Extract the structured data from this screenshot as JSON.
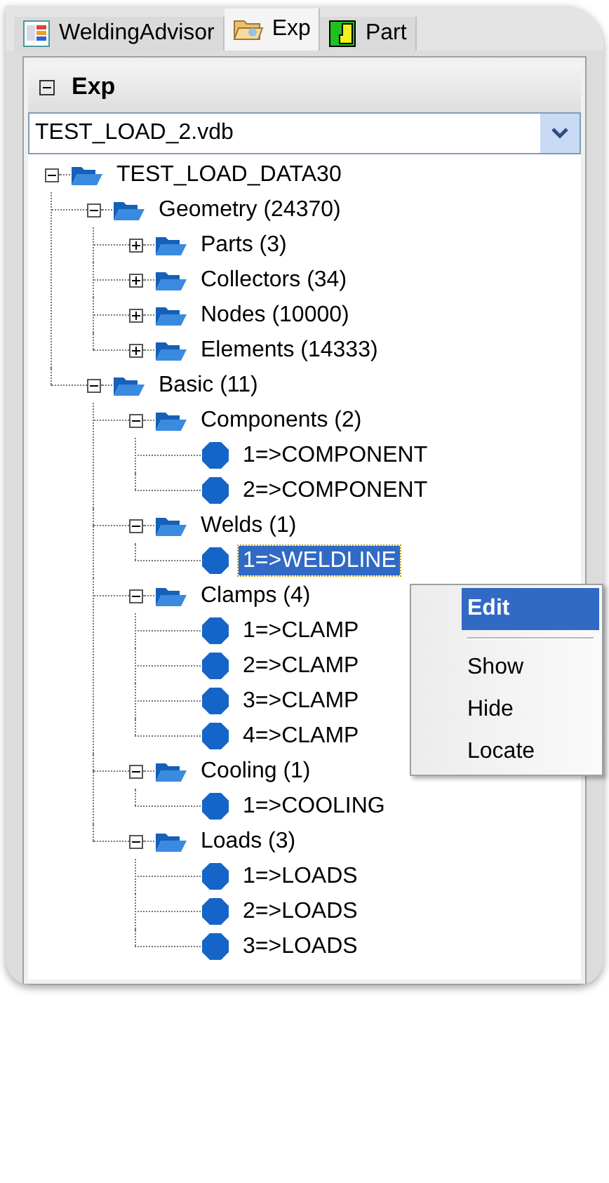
{
  "tabs": [
    {
      "label": "WeldingAdvisor",
      "kind": "chart",
      "selected": false
    },
    {
      "label": "Exp",
      "kind": "folder",
      "selected": true
    },
    {
      "label": "Part",
      "kind": "part",
      "selected": false
    }
  ],
  "panel": {
    "title": "Exp",
    "expanded": true
  },
  "file_dropdown": {
    "value": "TEST_LOAD_2.vdb"
  },
  "tree": [
    {
      "label": "TEST_LOAD_DATA30",
      "kind": "folder",
      "expanded": true,
      "selected": false,
      "children": [
        {
          "label": "Geometry (24370)",
          "kind": "folder",
          "expanded": true,
          "selected": false,
          "children": [
            {
              "label": "Parts (3)",
              "kind": "folder",
              "expanded": false,
              "selected": false
            },
            {
              "label": "Collectors (34)",
              "kind": "folder",
              "expanded": false,
              "selected": false
            },
            {
              "label": "Nodes (10000)",
              "kind": "folder",
              "expanded": false,
              "selected": false
            },
            {
              "label": "Elements (14333)",
              "kind": "folder",
              "expanded": false,
              "selected": false
            }
          ]
        },
        {
          "label": "Basic (11)",
          "kind": "folder",
          "expanded": true,
          "selected": false,
          "children": [
            {
              "label": "Components (2)",
              "kind": "folder",
              "expanded": true,
              "selected": false,
              "children": [
                {
                  "label": "1=>COMPONENT",
                  "kind": "leaf",
                  "selected": false
                },
                {
                  "label": "2=>COMPONENT",
                  "kind": "leaf",
                  "selected": false
                }
              ]
            },
            {
              "label": "Welds (1)",
              "kind": "folder",
              "expanded": true,
              "selected": false,
              "children": [
                {
                  "label": "1=>WELDLINE",
                  "kind": "leaf",
                  "selected": true
                }
              ]
            },
            {
              "label": "Clamps (4)",
              "kind": "folder",
              "expanded": true,
              "selected": false,
              "children": [
                {
                  "label": "1=>CLAMP",
                  "kind": "leaf",
                  "selected": false
                },
                {
                  "label": "2=>CLAMP",
                  "kind": "leaf",
                  "selected": false
                },
                {
                  "label": "3=>CLAMP",
                  "kind": "leaf",
                  "selected": false
                },
                {
                  "label": "4=>CLAMP",
                  "kind": "leaf",
                  "selected": false
                }
              ]
            },
            {
              "label": "Cooling (1)",
              "kind": "folder",
              "expanded": true,
              "selected": false,
              "children": [
                {
                  "label": "1=>COOLING",
                  "kind": "leaf",
                  "selected": false
                }
              ]
            },
            {
              "label": "Loads (3)",
              "kind": "folder",
              "expanded": true,
              "selected": false,
              "children": [
                {
                  "label": "1=>LOADS",
                  "kind": "leaf",
                  "selected": false
                },
                {
                  "label": "2=>LOADS",
                  "kind": "leaf",
                  "selected": false
                },
                {
                  "label": "3=>LOADS",
                  "kind": "leaf",
                  "selected": false
                }
              ]
            }
          ]
        }
      ]
    }
  ],
  "context_menu": [
    {
      "kind": "item",
      "label": "Edit",
      "selected": true
    },
    {
      "kind": "separator"
    },
    {
      "kind": "item",
      "label": "Show",
      "selected": false
    },
    {
      "kind": "item",
      "label": "Hide",
      "selected": false
    },
    {
      "kind": "item",
      "label": "Locate",
      "selected": false
    }
  ]
}
